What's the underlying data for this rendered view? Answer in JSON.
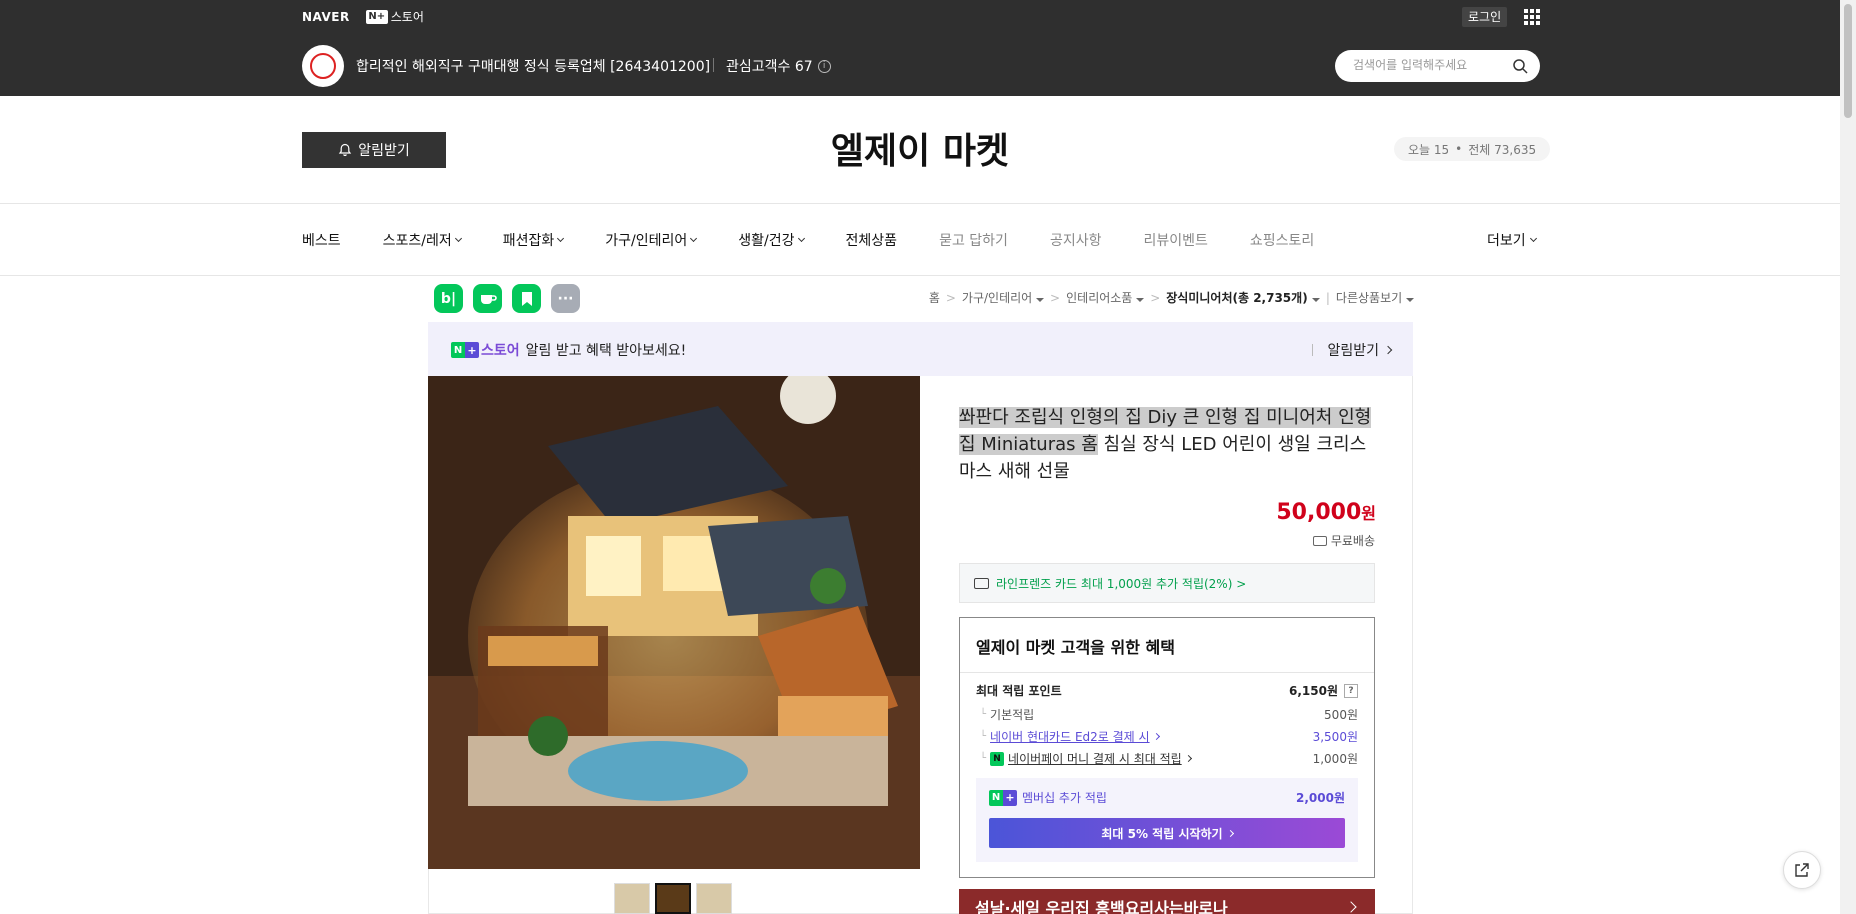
{
  "topbar": {
    "naver": "NAVER",
    "nstore_box": "N+",
    "nstore_label": "스토어",
    "login": "로그인",
    "store_name": "합리적인 해외직구 구매대행 정식 등록업체 [2643401200]",
    "fans_label": "관심고객수 67",
    "info_glyph": "i",
    "search_placeholder": "검색어를 입력해주세요"
  },
  "title_band": {
    "alarm_label": "알림받기",
    "shop_title": "엘제이 마켓",
    "today": "오늘 15",
    "dot": "•",
    "total": "전체 73,635"
  },
  "nav": {
    "items": [
      {
        "label": "베스트"
      },
      {
        "label": "스포츠/레저"
      },
      {
        "label": "패션잡화"
      },
      {
        "label": "가구/인테리어"
      },
      {
        "label": "생활/건강"
      },
      {
        "label": "전체상품"
      },
      {
        "label": "묻고 답하기"
      },
      {
        "label": "공지사항"
      },
      {
        "label": "리뷰이벤트"
      },
      {
        "label": "쇼핑스토리"
      }
    ],
    "more": "더보기"
  },
  "share": {
    "blog": "b|",
    "more": "···"
  },
  "breadcrumb": {
    "home": "홈",
    "sep": ">",
    "c1": "가구/인테리어",
    "c2": "인테리어소품",
    "c3": "장식미니어처",
    "c3_count": "(총 2,735개)",
    "other": "다른상품보기"
  },
  "alert_banner": {
    "store": "스토어",
    "n_letter": "N",
    "plus": "+",
    "message": "알림 받고 혜택 받아보세요!",
    "action": "알림받기"
  },
  "product": {
    "title_highlight": "쏴판다 조립식 인형의 집 Diy 큰 인형 집 미니어처 인형 집 Miniaturas 홈",
    "title_rest": " 침실 장식 LED 어린이 생일 크리스마스 새해 선물",
    "price_number": "50,000",
    "price_unit": "원",
    "shipping": "무료배송",
    "card_promo": "라인프렌즈 카드 최대 1,000원 추가 적립(2%) >"
  },
  "benefit": {
    "title": "엘제이 마켓 고객을 위한 혜택",
    "max_label": "최대 적립 포인트",
    "max_value": "6,150원",
    "question_mark": "?",
    "branch": "└",
    "basic_label": "기본적립",
    "basic_value": "500원",
    "hyundai_label": "네이버 현대카드 Ed2로 결제 시",
    "hyundai_value": "3,500원",
    "npay_glyph": "N",
    "npay_label": "네이버페이 머니 결제 시 최대 적립",
    "npay_value": "1,000원",
    "member_label": "멤버십 추가 적립",
    "member_value": "2,000원",
    "member_btn": "최대 5% 적립 시작하기",
    "sale_banner": "설날·세일 우리집 흥백요리사는바로나"
  },
  "colors": {
    "accent_red": "#d0021b",
    "naver_green": "#03c75a",
    "naver_purple": "#5b4bd6",
    "header_dark": "#2f2f2f"
  }
}
